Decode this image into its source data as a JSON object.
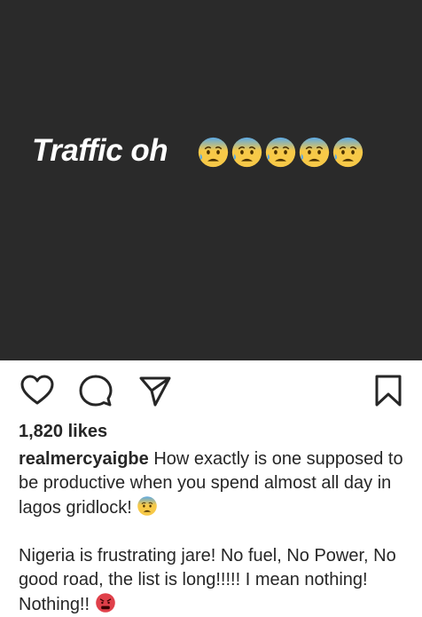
{
  "post": {
    "image_text": "Traffic oh",
    "image_background": "#2a2a2a",
    "emoji_icons": [
      "anxious-sweat-face-icon",
      "anxious-sweat-face-icon",
      "anxious-sweat-face-icon",
      "anxious-sweat-face-icon",
      "anxious-sweat-face-icon"
    ]
  },
  "actions": {
    "like_icon": "heart-icon",
    "comment_icon": "comment-bubble-icon",
    "share_icon": "send-icon",
    "save_icon": "bookmark-icon"
  },
  "likes": "1,820 likes",
  "caption": {
    "username": "realmercyaigbe",
    "line1": " How exactly is one supposed to be productive when you spend almost all day in lagos gridlock! ",
    "line1_emoji": "anxious-sweat-face-icon",
    "line2": "Nigeria is frustrating jare! No fuel, No Power, No good road, the list is long!!!!! I mean nothing! Nothing!! ",
    "line2_emoji": "angry-face-icon"
  },
  "colors": {
    "text": "#262626",
    "emoji_yellow": "#f7c948",
    "emoji_blue": "#5aa9e6",
    "angry_red": "#e0404a"
  }
}
